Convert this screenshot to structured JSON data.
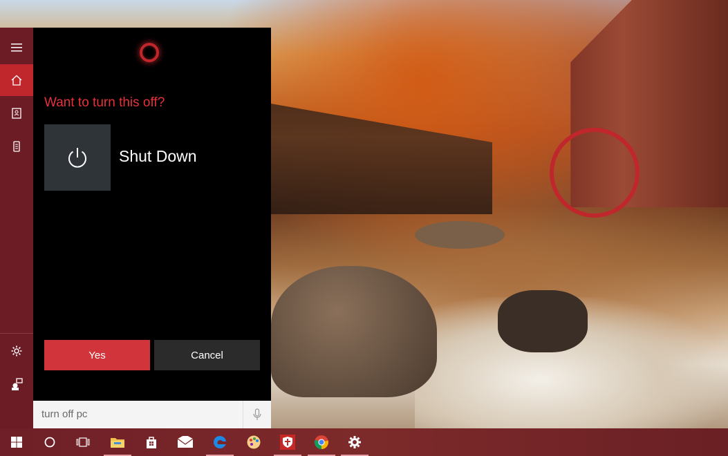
{
  "cortana": {
    "question": "Want to turn this off?",
    "action_label": "Shut Down",
    "yes_label": "Yes",
    "cancel_label": "Cancel",
    "search_value": "turn off pc"
  },
  "rail": {
    "items": [
      {
        "name": "menu-icon"
      },
      {
        "name": "home-icon",
        "active": true
      },
      {
        "name": "notebook-icon"
      },
      {
        "name": "device-icon"
      },
      {
        "name": "settings-icon"
      },
      {
        "name": "feedback-icon"
      }
    ]
  },
  "taskbar": {
    "items": [
      {
        "name": "start-button",
        "icon": "windows-logo-icon"
      },
      {
        "name": "cortana-button",
        "icon": "circle-icon"
      },
      {
        "name": "task-view-button",
        "icon": "task-view-icon"
      },
      {
        "name": "file-explorer-button",
        "icon": "folder-icon",
        "open": true
      },
      {
        "name": "store-button",
        "icon": "store-bag-icon"
      },
      {
        "name": "mail-button",
        "icon": "mail-icon"
      },
      {
        "name": "edge-button",
        "icon": "edge-icon",
        "open": true
      },
      {
        "name": "paint-button",
        "icon": "palette-icon"
      },
      {
        "name": "security-button",
        "icon": "shield-icon",
        "open": true
      },
      {
        "name": "chrome-button",
        "icon": "chrome-icon",
        "open": true
      },
      {
        "name": "settings-app-button",
        "icon": "gear-icon",
        "open": true
      }
    ]
  },
  "colors": {
    "accent": "#c0272d",
    "rail_bg": "#6b1c24",
    "question_text": "#e8313a",
    "panel_bg": "#000000"
  }
}
